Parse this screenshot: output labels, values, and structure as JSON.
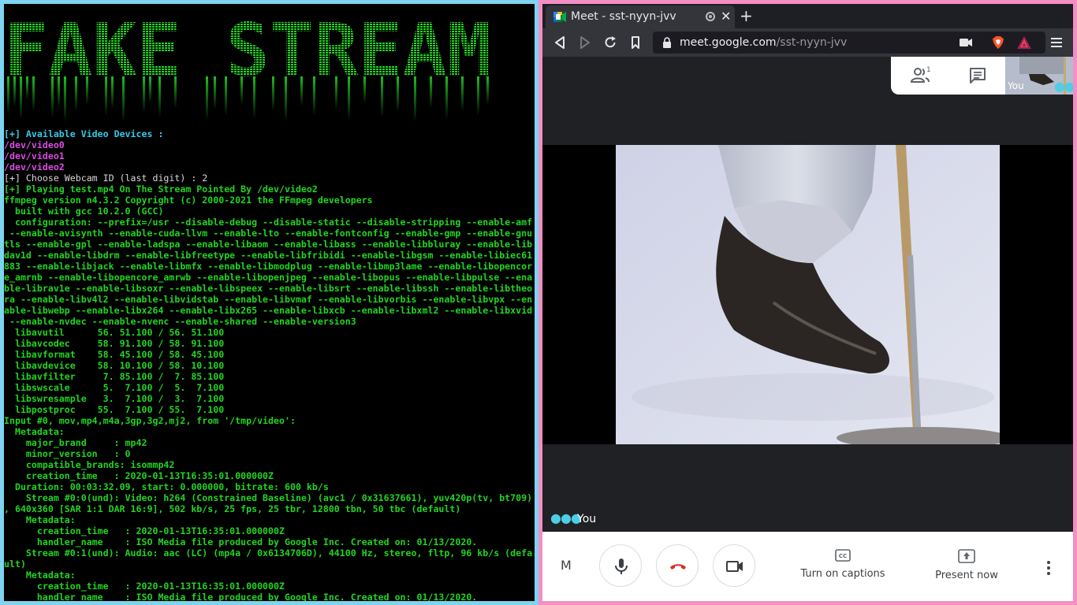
{
  "terminal": {
    "banner": "FAKE STREAM",
    "lines": [
      {
        "text": "[+] Available Video Devices :",
        "color": "cyan"
      },
      {
        "text": "/dev/video0",
        "color": "magenta"
      },
      {
        "text": "/dev/video1",
        "color": "magenta"
      },
      {
        "text": "/dev/video2",
        "color": "magenta"
      },
      {
        "text": "[+] Choose Webcam ID (last digit) : 2",
        "color": "white"
      },
      {
        "text": "[+] Playing test.mp4 On The Stream Pointed By /dev/video2",
        "color": "green"
      },
      {
        "text": "ffmpeg version n4.3.2 Copyright (c) 2000-2021 the FFmpeg developers",
        "color": "green"
      },
      {
        "text": "  built with gcc 10.2.0 (GCC)",
        "color": "green"
      },
      {
        "text": "  configuration: --prefix=/usr --disable-debug --disable-static --disable-stripping --enable-amf",
        "color": "green"
      },
      {
        "text": " --enable-avisynth --enable-cuda-llvm --enable-lto --enable-fontconfig --enable-gmp --enable-gnu",
        "color": "green"
      },
      {
        "text": "tls --enable-gpl --enable-ladspa --enable-libaom --enable-libass --enable-libbluray --enable-lib",
        "color": "green"
      },
      {
        "text": "dav1d --enable-libdrm --enable-libfreetype --enable-libfribidi --enable-libgsm --enable-libiec61",
        "color": "green"
      },
      {
        "text": "883 --enable-libjack --enable-libmfx --enable-libmodplug --enable-libmp3lame --enable-libopencor",
        "color": "green"
      },
      {
        "text": "e_amrnb --enable-libopencore_amrwb --enable-libopenjpeg --enable-libopus --enable-libpulse --ena",
        "color": "green"
      },
      {
        "text": "ble-librav1e --enable-libsoxr --enable-libspeex --enable-libsrt --enable-libssh --enable-libtheo",
        "color": "green"
      },
      {
        "text": "ra --enable-libv4l2 --enable-libvidstab --enable-libvmaf --enable-libvorbis --enable-libvpx --en",
        "color": "green"
      },
      {
        "text": "able-libwebp --enable-libx264 --enable-libx265 --enable-libxcb --enable-libxml2 --enable-libxvid",
        "color": "green"
      },
      {
        "text": " --enable-nvdec --enable-nvenc --enable-shared --enable-version3",
        "color": "green"
      },
      {
        "text": "  libavutil      56. 51.100 / 56. 51.100",
        "color": "green"
      },
      {
        "text": "  libavcodec     58. 91.100 / 58. 91.100",
        "color": "green"
      },
      {
        "text": "  libavformat    58. 45.100 / 58. 45.100",
        "color": "green"
      },
      {
        "text": "  libavdevice    58. 10.100 / 58. 10.100",
        "color": "green"
      },
      {
        "text": "  libavfilter     7. 85.100 /  7. 85.100",
        "color": "green"
      },
      {
        "text": "  libswscale      5.  7.100 /  5.  7.100",
        "color": "green"
      },
      {
        "text": "  libswresample   3.  7.100 /  3.  7.100",
        "color": "green"
      },
      {
        "text": "  libpostproc    55.  7.100 / 55.  7.100",
        "color": "green"
      },
      {
        "text": "Input #0, mov,mp4,m4a,3gp,3g2,mj2, from '/tmp/video':",
        "color": "green"
      },
      {
        "text": "  Metadata:",
        "color": "green"
      },
      {
        "text": "    major_brand     : mp42",
        "color": "green"
      },
      {
        "text": "    minor_version   : 0",
        "color": "green"
      },
      {
        "text": "    compatible_brands: isommp42",
        "color": "green"
      },
      {
        "text": "    creation_time   : 2020-01-13T16:35:01.000000Z",
        "color": "green"
      },
      {
        "text": "  Duration: 00:03:32.09, start: 0.000000, bitrate: 600 kb/s",
        "color": "green"
      },
      {
        "text": "    Stream #0:0(und): Video: h264 (Constrained Baseline) (avc1 / 0x31637661), yuv420p(tv, bt709)",
        "color": "green"
      },
      {
        "text": ", 640x360 [SAR 1:1 DAR 16:9], 502 kb/s, 25 fps, 25 tbr, 12800 tbn, 50 tbc (default)",
        "color": "green"
      },
      {
        "text": "    Metadata:",
        "color": "green"
      },
      {
        "text": "      creation_time   : 2020-01-13T16:35:01.000000Z",
        "color": "green"
      },
      {
        "text": "      handler_name    : ISO Media file produced by Google Inc. Created on: 01/13/2020.",
        "color": "green"
      },
      {
        "text": "    Stream #0:1(und): Audio: aac (LC) (mp4a / 0x6134706D), 44100 Hz, stereo, fltp, 96 kb/s (defa",
        "color": "green"
      },
      {
        "text": "ult)",
        "color": "green"
      },
      {
        "text": "    Metadata:",
        "color": "green"
      },
      {
        "text": "      creation_time   : 2020-01-13T16:35:01.000000Z",
        "color": "green"
      },
      {
        "text": "      handler_name    : ISO Media file produced by Google Inc. Created on: 01/13/2020.",
        "color": "green"
      }
    ]
  },
  "browser": {
    "tab": {
      "title": "Meet - sst-nyyn-jvv"
    },
    "url": {
      "host": "meet.google.com",
      "path": "/sst-nyyn-jvv"
    }
  },
  "meet": {
    "people_count": "1",
    "self_thumb_label": "You",
    "participant_label": "You",
    "name_truncated": "M",
    "captions_label": "Turn on captions",
    "present_label": "Present now"
  },
  "colors": {
    "terminal_border": "#7fd4f0",
    "browser_border": "#f38fc4",
    "banner_green": "#22d422",
    "hangup_red": "#d93025"
  }
}
